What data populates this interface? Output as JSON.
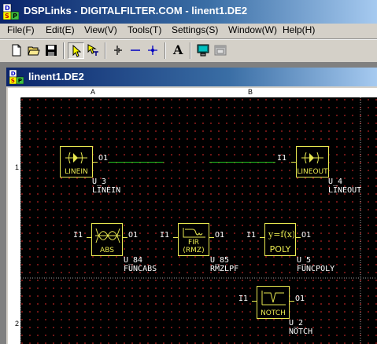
{
  "app": {
    "title": "DSPLinks - DIGITALFILTER.COM - linent1.DE2",
    "icon": "dsp-app-icon"
  },
  "menu": [
    {
      "label": "File(F)"
    },
    {
      "label": "Edit(E)"
    },
    {
      "label": "View(V)"
    },
    {
      "label": "Tools(T)"
    },
    {
      "label": "Settings(S)"
    },
    {
      "label": "Window(W)"
    },
    {
      "label": "Help(H)"
    }
  ],
  "toolbar": {
    "buttons": [
      "new-file-icon",
      "open-folder-icon",
      "save-disk-icon",
      "select-arrow-icon",
      "wire-tool-icon",
      "split-tool-icon",
      "line-tool-icon",
      "node-tool-icon",
      "text-tool-icon",
      "monitor-icon",
      "window-icon"
    ],
    "text_button_label": "A"
  },
  "document": {
    "title": "linent1.DE2",
    "columns": [
      "A",
      "B"
    ],
    "rows": [
      "1",
      "2"
    ]
  },
  "blocks": [
    {
      "id": "U_3",
      "type": "LINEIN",
      "label": "LINEIN",
      "ports_in": [],
      "ports_out": [
        "O1"
      ]
    },
    {
      "id": "U_4",
      "type": "LINEOUT",
      "label": "LINEOUT",
      "ports_in": [
        "I1"
      ],
      "ports_out": []
    },
    {
      "id": "U_84",
      "type": "FUNCABS",
      "label": "ABS",
      "ports_in": [
        "I1"
      ],
      "ports_out": [
        "O1"
      ]
    },
    {
      "id": "U_85",
      "type": "RMZLPF",
      "label": "FIR\n(RMZ)",
      "label_line1": "FIR",
      "label_line2": "(RMZ)",
      "ports_in": [
        "I1"
      ],
      "ports_out": [
        "O1"
      ]
    },
    {
      "id": "U_5",
      "type": "FUNCPOLY",
      "label": "POLY",
      "ports_in": [
        "I1"
      ],
      "ports_out": [
        "O1"
      ]
    },
    {
      "id": "U_2",
      "type": "NOTCH",
      "label": "NOTCH",
      "ports_in": [
        "I1"
      ],
      "ports_out": [
        "O1"
      ]
    }
  ],
  "colors": {
    "canvas": "#000000",
    "grid_dot": "#8a1a1a",
    "block_border": "#e8e850",
    "wire": "#22c422",
    "text": "#ffffff"
  }
}
